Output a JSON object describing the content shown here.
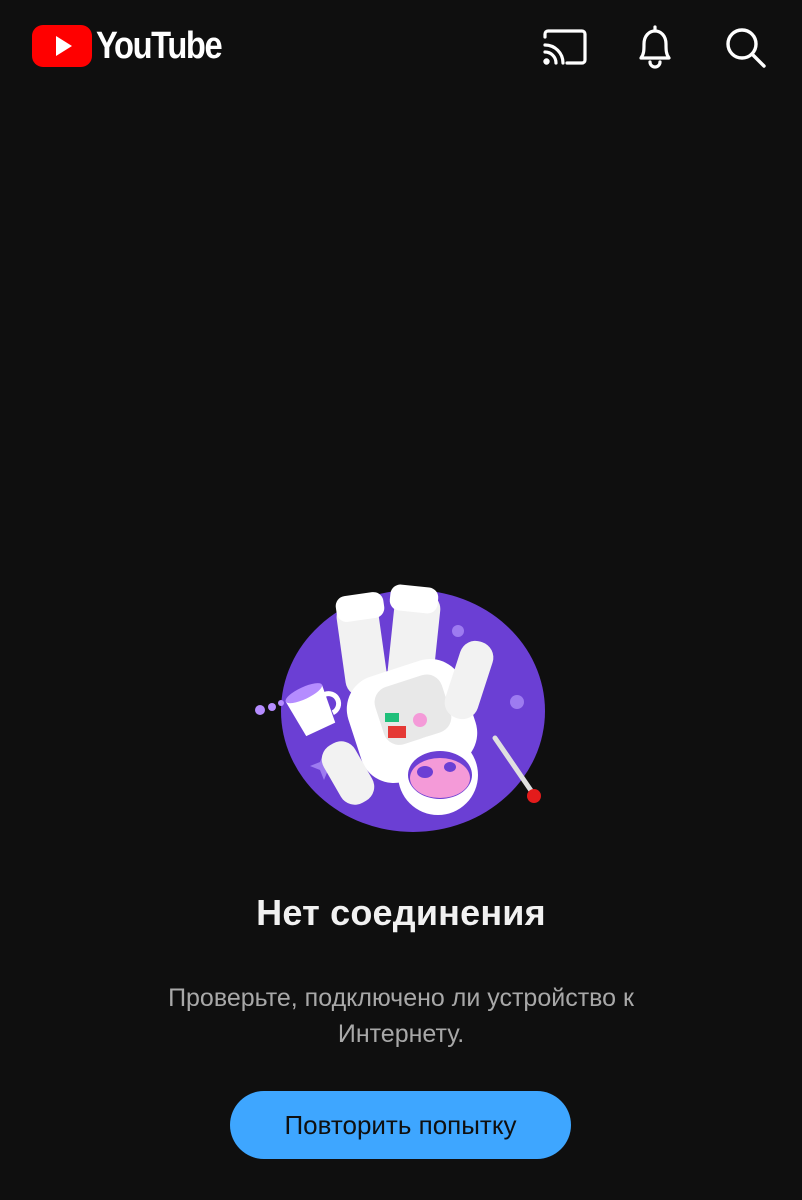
{
  "header": {
    "logo_text": "YouTube",
    "icons": [
      "cast-icon",
      "bell-icon",
      "search-icon"
    ]
  },
  "error": {
    "title": "Нет соединения",
    "message": "Проверьте, подключено ли устройство к Интернету.",
    "retry_label": "Повторить попытку"
  },
  "colors": {
    "background": "#0f0f0f",
    "brand_red": "#ff0000",
    "button_blue": "#3ea6ff",
    "illustration_purple": "#6b3fd4"
  }
}
